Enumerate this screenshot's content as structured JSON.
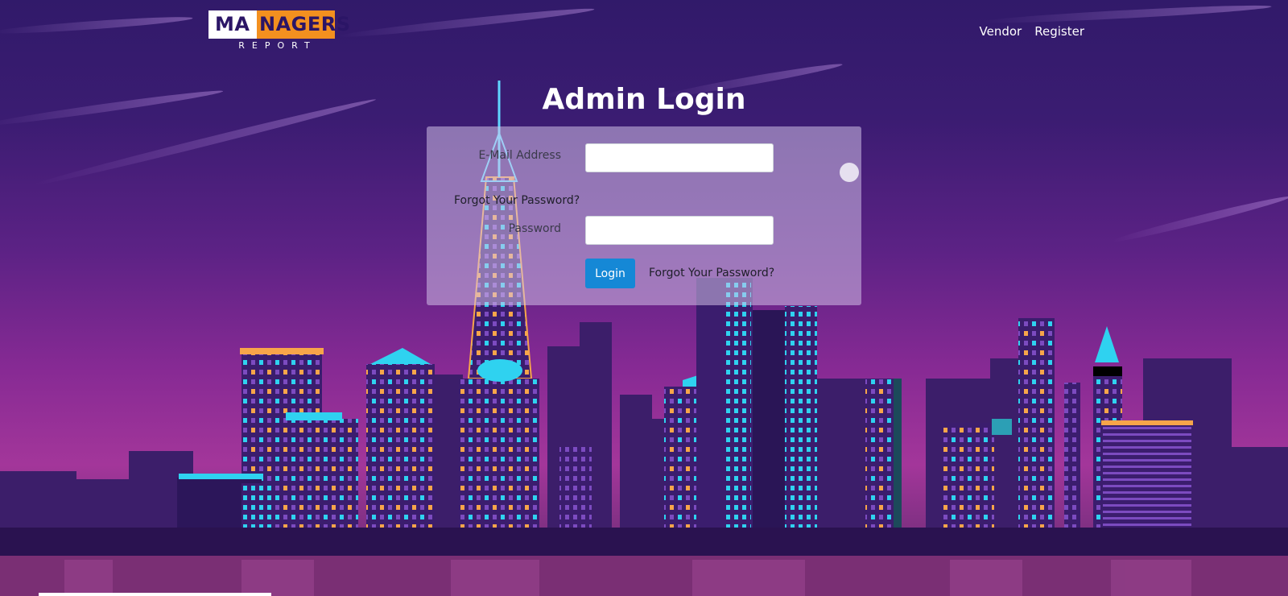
{
  "header": {
    "logo_ma": "MA",
    "logo_agers": "NAGERS",
    "logo_sub": "REPORT",
    "nav": [
      {
        "label": "Vendor"
      },
      {
        "label": "Register"
      }
    ]
  },
  "login": {
    "title": "Admin Login",
    "email_label": "E-Mail Address",
    "email_value": "",
    "forgot_top": "Forgot Your Password?",
    "password_label": "Password",
    "password_value": "",
    "login_button": "Login",
    "forgot_bottom": "Forgot Your Password?"
  },
  "colors": {
    "brand_orange": "#f3901f",
    "brand_navy": "#2b1566",
    "button_blue": "#1588d6"
  }
}
